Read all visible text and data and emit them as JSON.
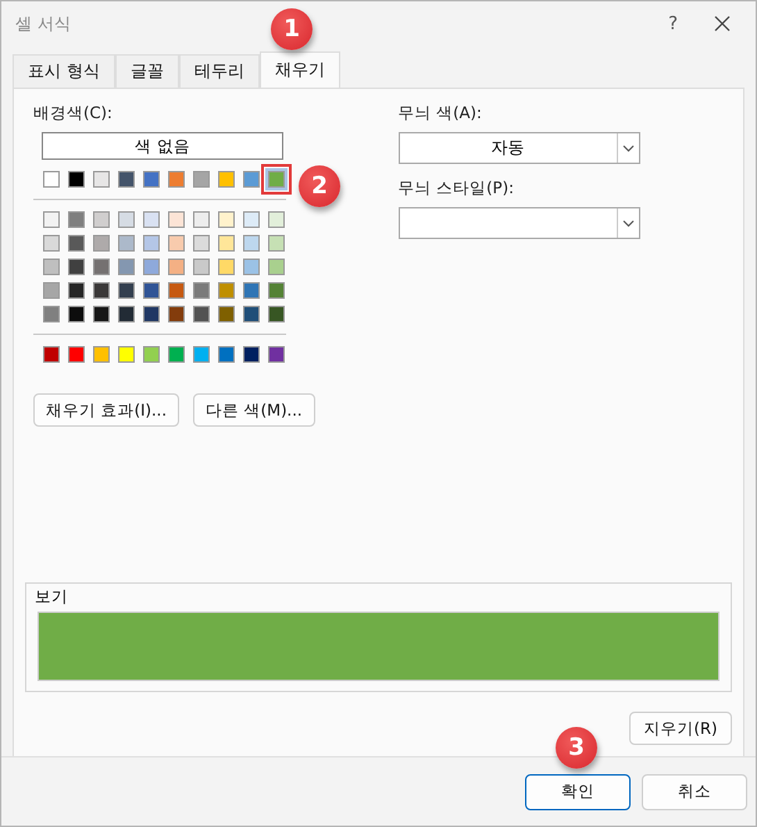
{
  "window": {
    "title": "셀 서식",
    "help": "?"
  },
  "tabs": [
    {
      "label": "표시 형식",
      "selected": false
    },
    {
      "label": "글꼴",
      "selected": false
    },
    {
      "label": "테두리",
      "selected": false
    },
    {
      "label": "채우기",
      "selected": true
    }
  ],
  "background": {
    "label": "배경색(C):",
    "no_color_button": "색 없음",
    "theme_colors": [
      {
        "color": "#ffffff",
        "selected": false
      },
      {
        "color": "#000000",
        "selected": false
      },
      {
        "color": "#e7e6e6",
        "selected": false
      },
      {
        "color": "#44546a",
        "selected": false
      },
      {
        "color": "#4472c4",
        "selected": false
      },
      {
        "color": "#ed7d31",
        "selected": false
      },
      {
        "color": "#a5a5a5",
        "selected": false
      },
      {
        "color": "#ffc000",
        "selected": false
      },
      {
        "color": "#5b9bd5",
        "selected": false
      },
      {
        "color": "#70ad47",
        "selected": true
      }
    ],
    "shades": [
      [
        {
          "color": "#f2f2f2"
        },
        {
          "color": "#7f7f7f"
        },
        {
          "color": "#d0cece"
        },
        {
          "color": "#d6dce4"
        },
        {
          "color": "#d9e1f2"
        },
        {
          "color": "#fce4d6"
        },
        {
          "color": "#ededed"
        },
        {
          "color": "#fff2cc"
        },
        {
          "color": "#ddebf7"
        },
        {
          "color": "#e2efda"
        }
      ],
      [
        {
          "color": "#d9d9d9"
        },
        {
          "color": "#595959"
        },
        {
          "color": "#aeaaaa"
        },
        {
          "color": "#acb9ca"
        },
        {
          "color": "#b4c6e7"
        },
        {
          "color": "#f8cbad"
        },
        {
          "color": "#dbdbdb"
        },
        {
          "color": "#ffe699"
        },
        {
          "color": "#bdd7ee"
        },
        {
          "color": "#c6e0b4"
        }
      ],
      [
        {
          "color": "#bfbfbf"
        },
        {
          "color": "#404040"
        },
        {
          "color": "#757171"
        },
        {
          "color": "#8497b0"
        },
        {
          "color": "#8ea9db"
        },
        {
          "color": "#f4b084"
        },
        {
          "color": "#c9c9c9"
        },
        {
          "color": "#ffd966"
        },
        {
          "color": "#9bc2e6"
        },
        {
          "color": "#a9d08e"
        }
      ],
      [
        {
          "color": "#a6a6a6"
        },
        {
          "color": "#262626"
        },
        {
          "color": "#3a3838"
        },
        {
          "color": "#333f4f"
        },
        {
          "color": "#305496"
        },
        {
          "color": "#c65911"
        },
        {
          "color": "#7b7b7b"
        },
        {
          "color": "#bf8f00"
        },
        {
          "color": "#2f75b5"
        },
        {
          "color": "#548235"
        }
      ],
      [
        {
          "color": "#808080"
        },
        {
          "color": "#0d0d0d"
        },
        {
          "color": "#161616"
        },
        {
          "color": "#222b35"
        },
        {
          "color": "#203764"
        },
        {
          "color": "#833c0c"
        },
        {
          "color": "#525252"
        },
        {
          "color": "#7f6000"
        },
        {
          "color": "#1f4e78"
        },
        {
          "color": "#375623"
        }
      ]
    ],
    "standard_colors": [
      {
        "color": "#c00000"
      },
      {
        "color": "#ff0000"
      },
      {
        "color": "#ffc000"
      },
      {
        "color": "#ffff00"
      },
      {
        "color": "#92d050"
      },
      {
        "color": "#00b050"
      },
      {
        "color": "#00b0f0"
      },
      {
        "color": "#0070c0"
      },
      {
        "color": "#002060"
      },
      {
        "color": "#7030a0"
      }
    ],
    "fill_effects_button": "채우기 효과(I)...",
    "more_colors_button": "다른 색(M)..."
  },
  "pattern_color": {
    "label": "무늬 색(A):",
    "value": "자동"
  },
  "pattern_style": {
    "label": "무늬 스타일(P):"
  },
  "preview": {
    "label": "보기",
    "color": "#70ad47"
  },
  "clear_button": "지우기(R)",
  "buttons": [
    {
      "label": "확인",
      "default": true
    },
    {
      "label": "취소",
      "default": false
    }
  ],
  "callouts": [
    "1",
    "2",
    "3"
  ]
}
